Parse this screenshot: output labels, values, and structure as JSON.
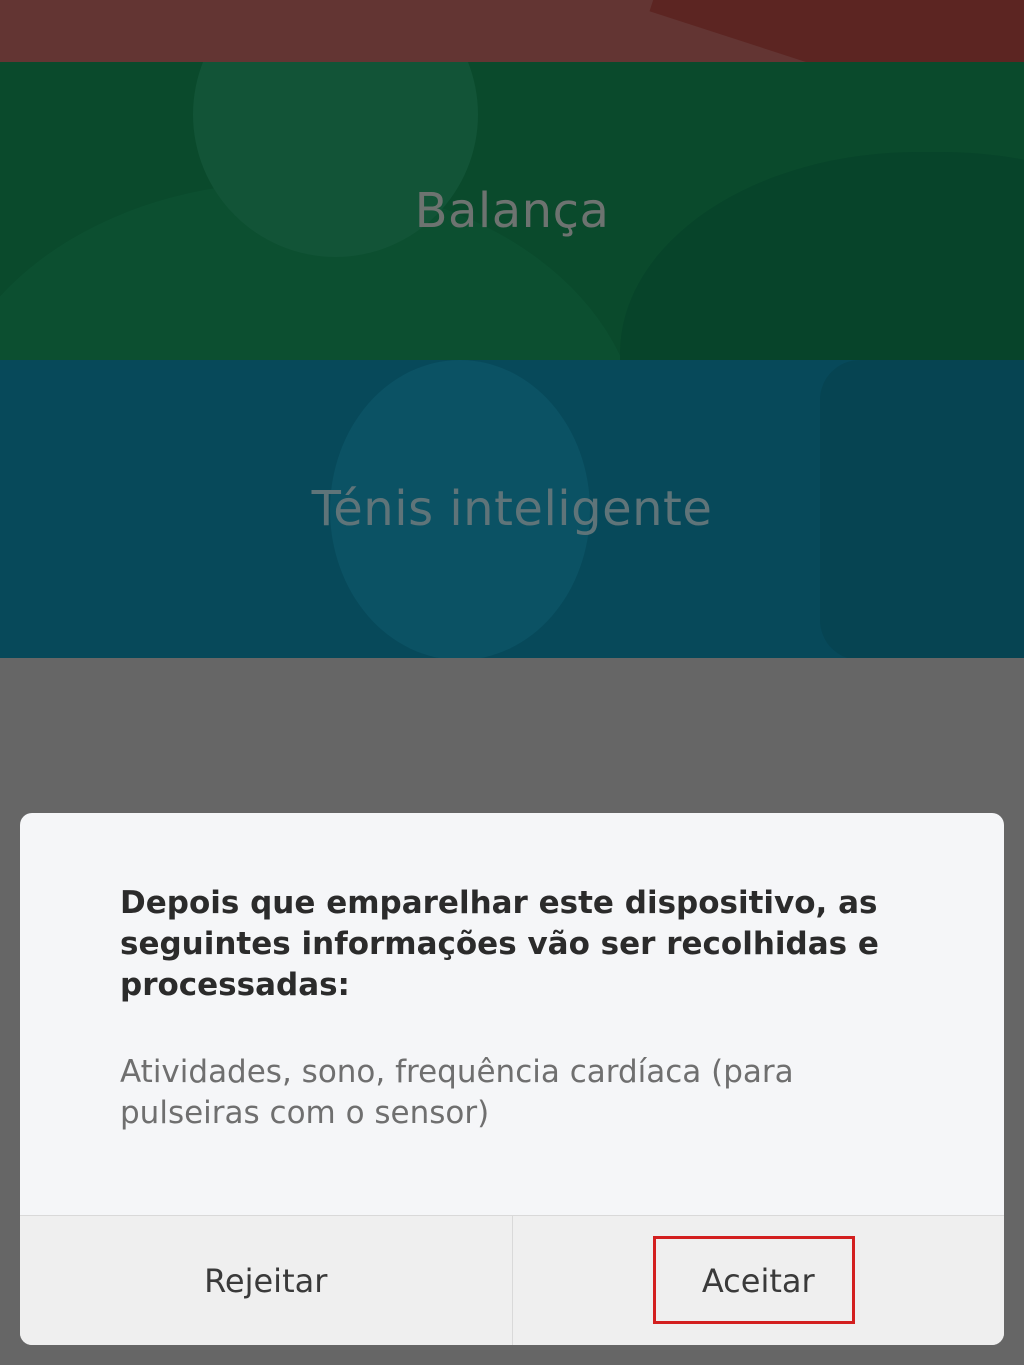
{
  "devices": [
    {
      "label": ""
    },
    {
      "label": "Balança"
    },
    {
      "label": "Ténis inteligente"
    }
  ],
  "dialog": {
    "title": "Depois que emparelhar este dispositivo, as seguintes informações vão ser recolhidas e processadas:",
    "message": "Atividades, sono, frequência cardíaca (para pulseiras com o sensor)",
    "reject_label": "Rejeitar",
    "accept_label": "Aceitar"
  },
  "colors": {
    "overlay": "#666666",
    "highlight": "#d31f1f"
  }
}
